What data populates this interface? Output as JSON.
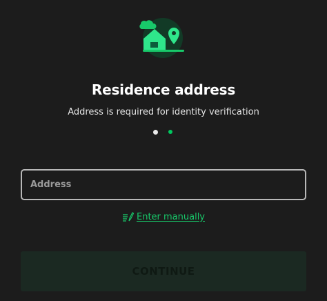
{
  "form": {
    "title": "Residence address",
    "subtitle": "Address is required for identity verification",
    "address_placeholder": "Address",
    "address_value": "",
    "manual_link_label": "Enter manually",
    "continue_label": "CONTINUE"
  },
  "steps": {
    "current": 1,
    "total": 2
  },
  "icons": {
    "hero": "house-location-illustration",
    "manual": "pencil-notes-icon"
  },
  "colors": {
    "background": "#1c1c1c",
    "accent": "#18c96a",
    "button_disabled_bg": "#1b2922",
    "field_border": "#b8b8b8"
  }
}
